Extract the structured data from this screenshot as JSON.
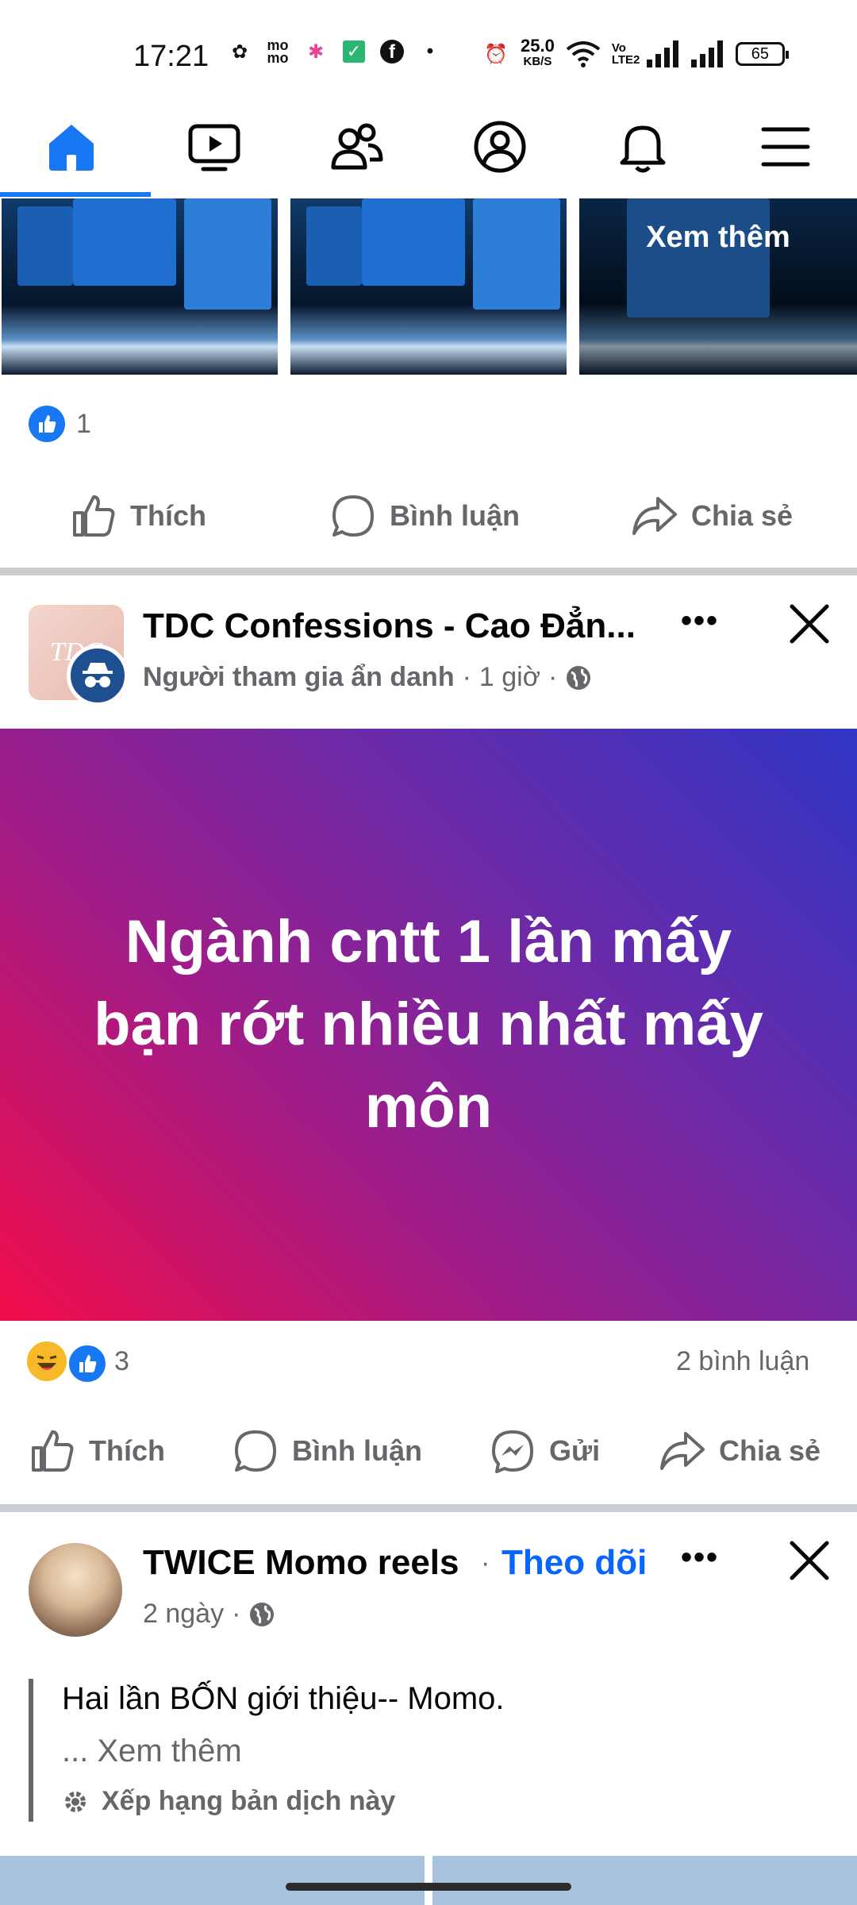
{
  "status_bar": {
    "time": "17:21",
    "net_speed_value": "25.0",
    "net_speed_unit": "KB/S",
    "volte_label": "Vo LTE2",
    "battery": "65",
    "icons": [
      "circle-app-icon",
      "mo-mo-icon",
      "colorful-app-icon",
      "green-check-app-icon",
      "facebook-icon",
      "dot-icon",
      "alarm-icon",
      "wifi-icon",
      "signal-icon",
      "signal-icon",
      "battery-icon"
    ]
  },
  "nav": {
    "items": [
      "home-icon",
      "video-icon",
      "friends-icon",
      "profile-icon",
      "bell-icon",
      "menu-icon"
    ],
    "active": "home-icon",
    "accent": "#1877f2"
  },
  "post1": {
    "more_overlay": "Xem thêm",
    "reaction_count": "1",
    "actions": {
      "like": "Thích",
      "comment": "Bình luận",
      "share": "Chia sẻ"
    }
  },
  "post2": {
    "group_name": "TDC Confessions - Cao Đẳn...",
    "author": "Người tham gia ẩn danh",
    "sep": "·",
    "time": "1 giờ",
    "body": "Ngành cntt 1 lần mấy bạn rớt nhiều nhất mấy môn",
    "reaction_count": "3",
    "comment_count": "2 bình luận",
    "actions": {
      "like": "Thích",
      "comment": "Bình luận",
      "send": "Gửi",
      "share": "Chia sẻ"
    }
  },
  "post3": {
    "page_name": "TWICE Momo reels",
    "sep": "·",
    "follow": "Theo dõi",
    "time": "2 ngày",
    "text": "Hai lần BỐN giới thiệu-- Momo.",
    "see_more": "... Xem thêm",
    "rate_translation": "Xếp hạng bản dịch này"
  }
}
